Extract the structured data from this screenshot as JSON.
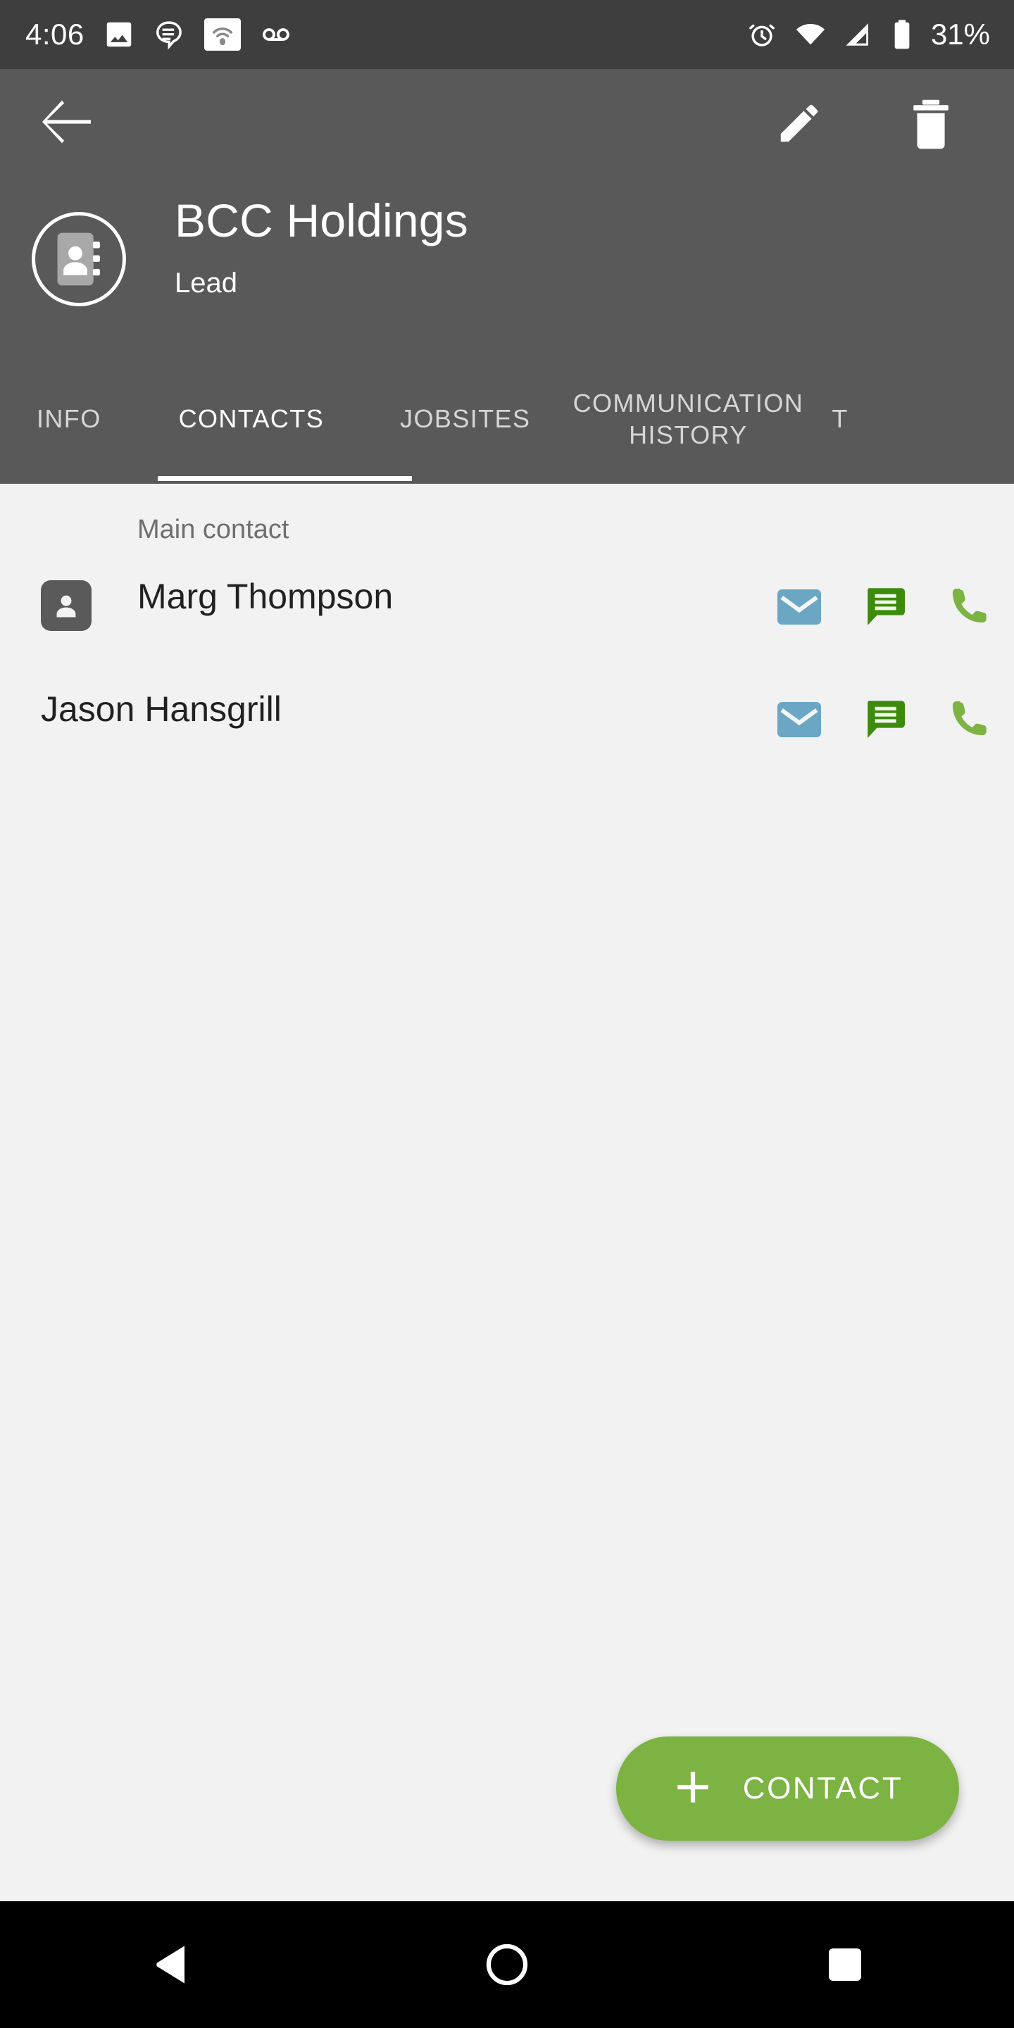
{
  "status_bar": {
    "time": "4:06",
    "battery_percent": "31%",
    "left_icons": [
      "screenshot-icon",
      "message-icon",
      "hotspot-icon",
      "voicemail-icon"
    ],
    "right_icons": [
      "alarm-icon",
      "wifi-icon",
      "cellular-signal-icon",
      "battery-icon"
    ],
    "background": "#3E3E3E"
  },
  "app_bar": {
    "background": "#595959",
    "back_label": "back-arrow",
    "edit_label": "edit",
    "delete_label": "delete",
    "avatar_icon": "contact-book-icon",
    "title": "BCC Holdings",
    "subtitle": "Lead"
  },
  "tabs": {
    "items": [
      {
        "label": "INFO",
        "active": false
      },
      {
        "label": "CONTACTS",
        "active": true
      },
      {
        "label": "JOBSITES",
        "active": false
      },
      {
        "label": "COMMUNICATION HISTORY",
        "active": false
      },
      {
        "label": "T",
        "active": false
      }
    ],
    "active_index": 1,
    "indicator_color": "#FFFFFF"
  },
  "content": {
    "background": "#F2F2F2",
    "section_label": "Main contact",
    "contacts": [
      {
        "name": "Marg Thompson",
        "has_avatar": true,
        "actions": [
          "email-icon",
          "sms-icon",
          "call-icon"
        ]
      },
      {
        "name": "Jason Hansgrill",
        "has_avatar": false,
        "actions": [
          "email-icon",
          "sms-icon",
          "call-icon"
        ]
      }
    ],
    "action_colors": {
      "email": "#6BA6C4",
      "sms": "#3D8B0C",
      "call": "#7CB342"
    }
  },
  "fab": {
    "label": "CONTACT",
    "icon": "plus-icon",
    "color": "#7CB342"
  },
  "nav_bar": {
    "background": "#000000",
    "buttons": [
      "back-triangle-icon",
      "home-circle-icon",
      "recents-square-icon"
    ]
  }
}
